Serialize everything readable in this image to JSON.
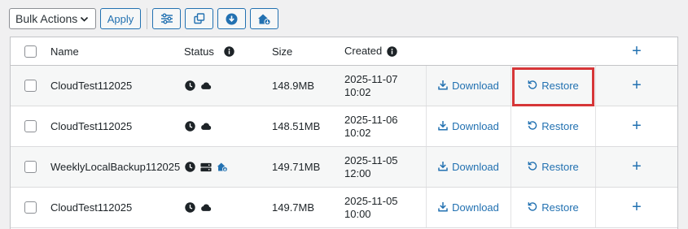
{
  "toolbar": {
    "bulk_actions": "Bulk Actions",
    "apply": "Apply",
    "icons": [
      "sliders-icon",
      "copy-icon",
      "download-circle-icon",
      "house-cloud-icon"
    ]
  },
  "table": {
    "headers": {
      "name": "Name",
      "status": "Status",
      "size": "Size",
      "created": "Created",
      "add": "+"
    },
    "rows": [
      {
        "name": "CloudTest112025",
        "status_icons": [
          "clock-icon",
          "cloud-icon"
        ],
        "size": "148.9MB",
        "date": "2025-11-07",
        "time": "10:02",
        "download": "Download",
        "restore": "Restore",
        "add": "+"
      },
      {
        "name": "CloudTest112025",
        "status_icons": [
          "clock-icon",
          "cloud-icon"
        ],
        "size": "148.51MB",
        "date": "2025-11-06",
        "time": "10:02",
        "download": "Download",
        "restore": "Restore",
        "add": "+"
      },
      {
        "name": "WeeklyLocalBackup112025",
        "status_icons": [
          "clock-icon",
          "server-icon",
          "house-cloud-icon"
        ],
        "size": "149.71MB",
        "date": "2025-11-05",
        "time": "12:00",
        "download": "Download",
        "restore": "Restore",
        "add": "+"
      },
      {
        "name": "CloudTest112025",
        "status_icons": [
          "clock-icon",
          "cloud-icon"
        ],
        "size": "149.7MB",
        "date": "2025-11-05",
        "time": "10:00",
        "download": "Download",
        "restore": "Restore",
        "add": "+"
      }
    ]
  },
  "colors": {
    "accent": "#2271b1",
    "highlight": "#d63638"
  }
}
